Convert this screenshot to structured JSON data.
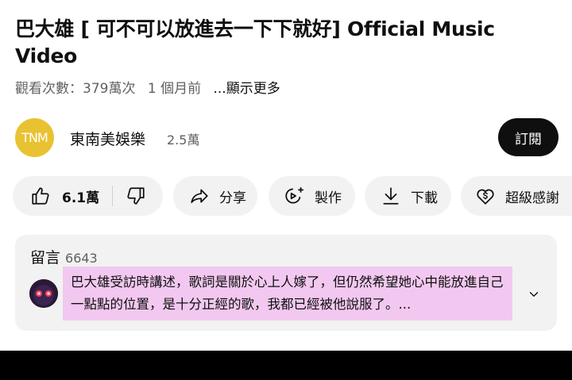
{
  "video": {
    "title": "巴大雄 [ 可不可以放進去一下下就好] Official Music Video",
    "views": "觀看次數：379萬次",
    "age": "1 個月前",
    "more": "...顯示更多"
  },
  "channel": {
    "avatar_text": "TNM",
    "name": "東南美娛樂",
    "subscribers": "2.5萬",
    "subscribe_label": "訂閱",
    "avatar_color": "#e9c232"
  },
  "actions": {
    "like_count": "6.1萬",
    "share": "分享",
    "remix": "製作",
    "download": "下載",
    "thanks": "超級感謝"
  },
  "comments": {
    "heading": "留言",
    "count": "6643",
    "top_comment": "巴大雄受訪時講述，歌詞是關於心上人嫁了，但仍然希望她心中能放進自己一點點的位置，是十分正經的歌，我都已經被他說服了。..."
  },
  "icons": {
    "like": "thumb-up-icon",
    "dislike": "thumb-down-icon",
    "share": "share-arrow-icon",
    "remix": "remix-icon",
    "download": "download-icon",
    "thanks": "super-thanks-icon",
    "expand": "chevron-down-icon"
  },
  "colors": {
    "highlight": "#f2c8f0",
    "pill_background": "#f2f2f2",
    "subscribe_background": "#0f0f0f"
  }
}
